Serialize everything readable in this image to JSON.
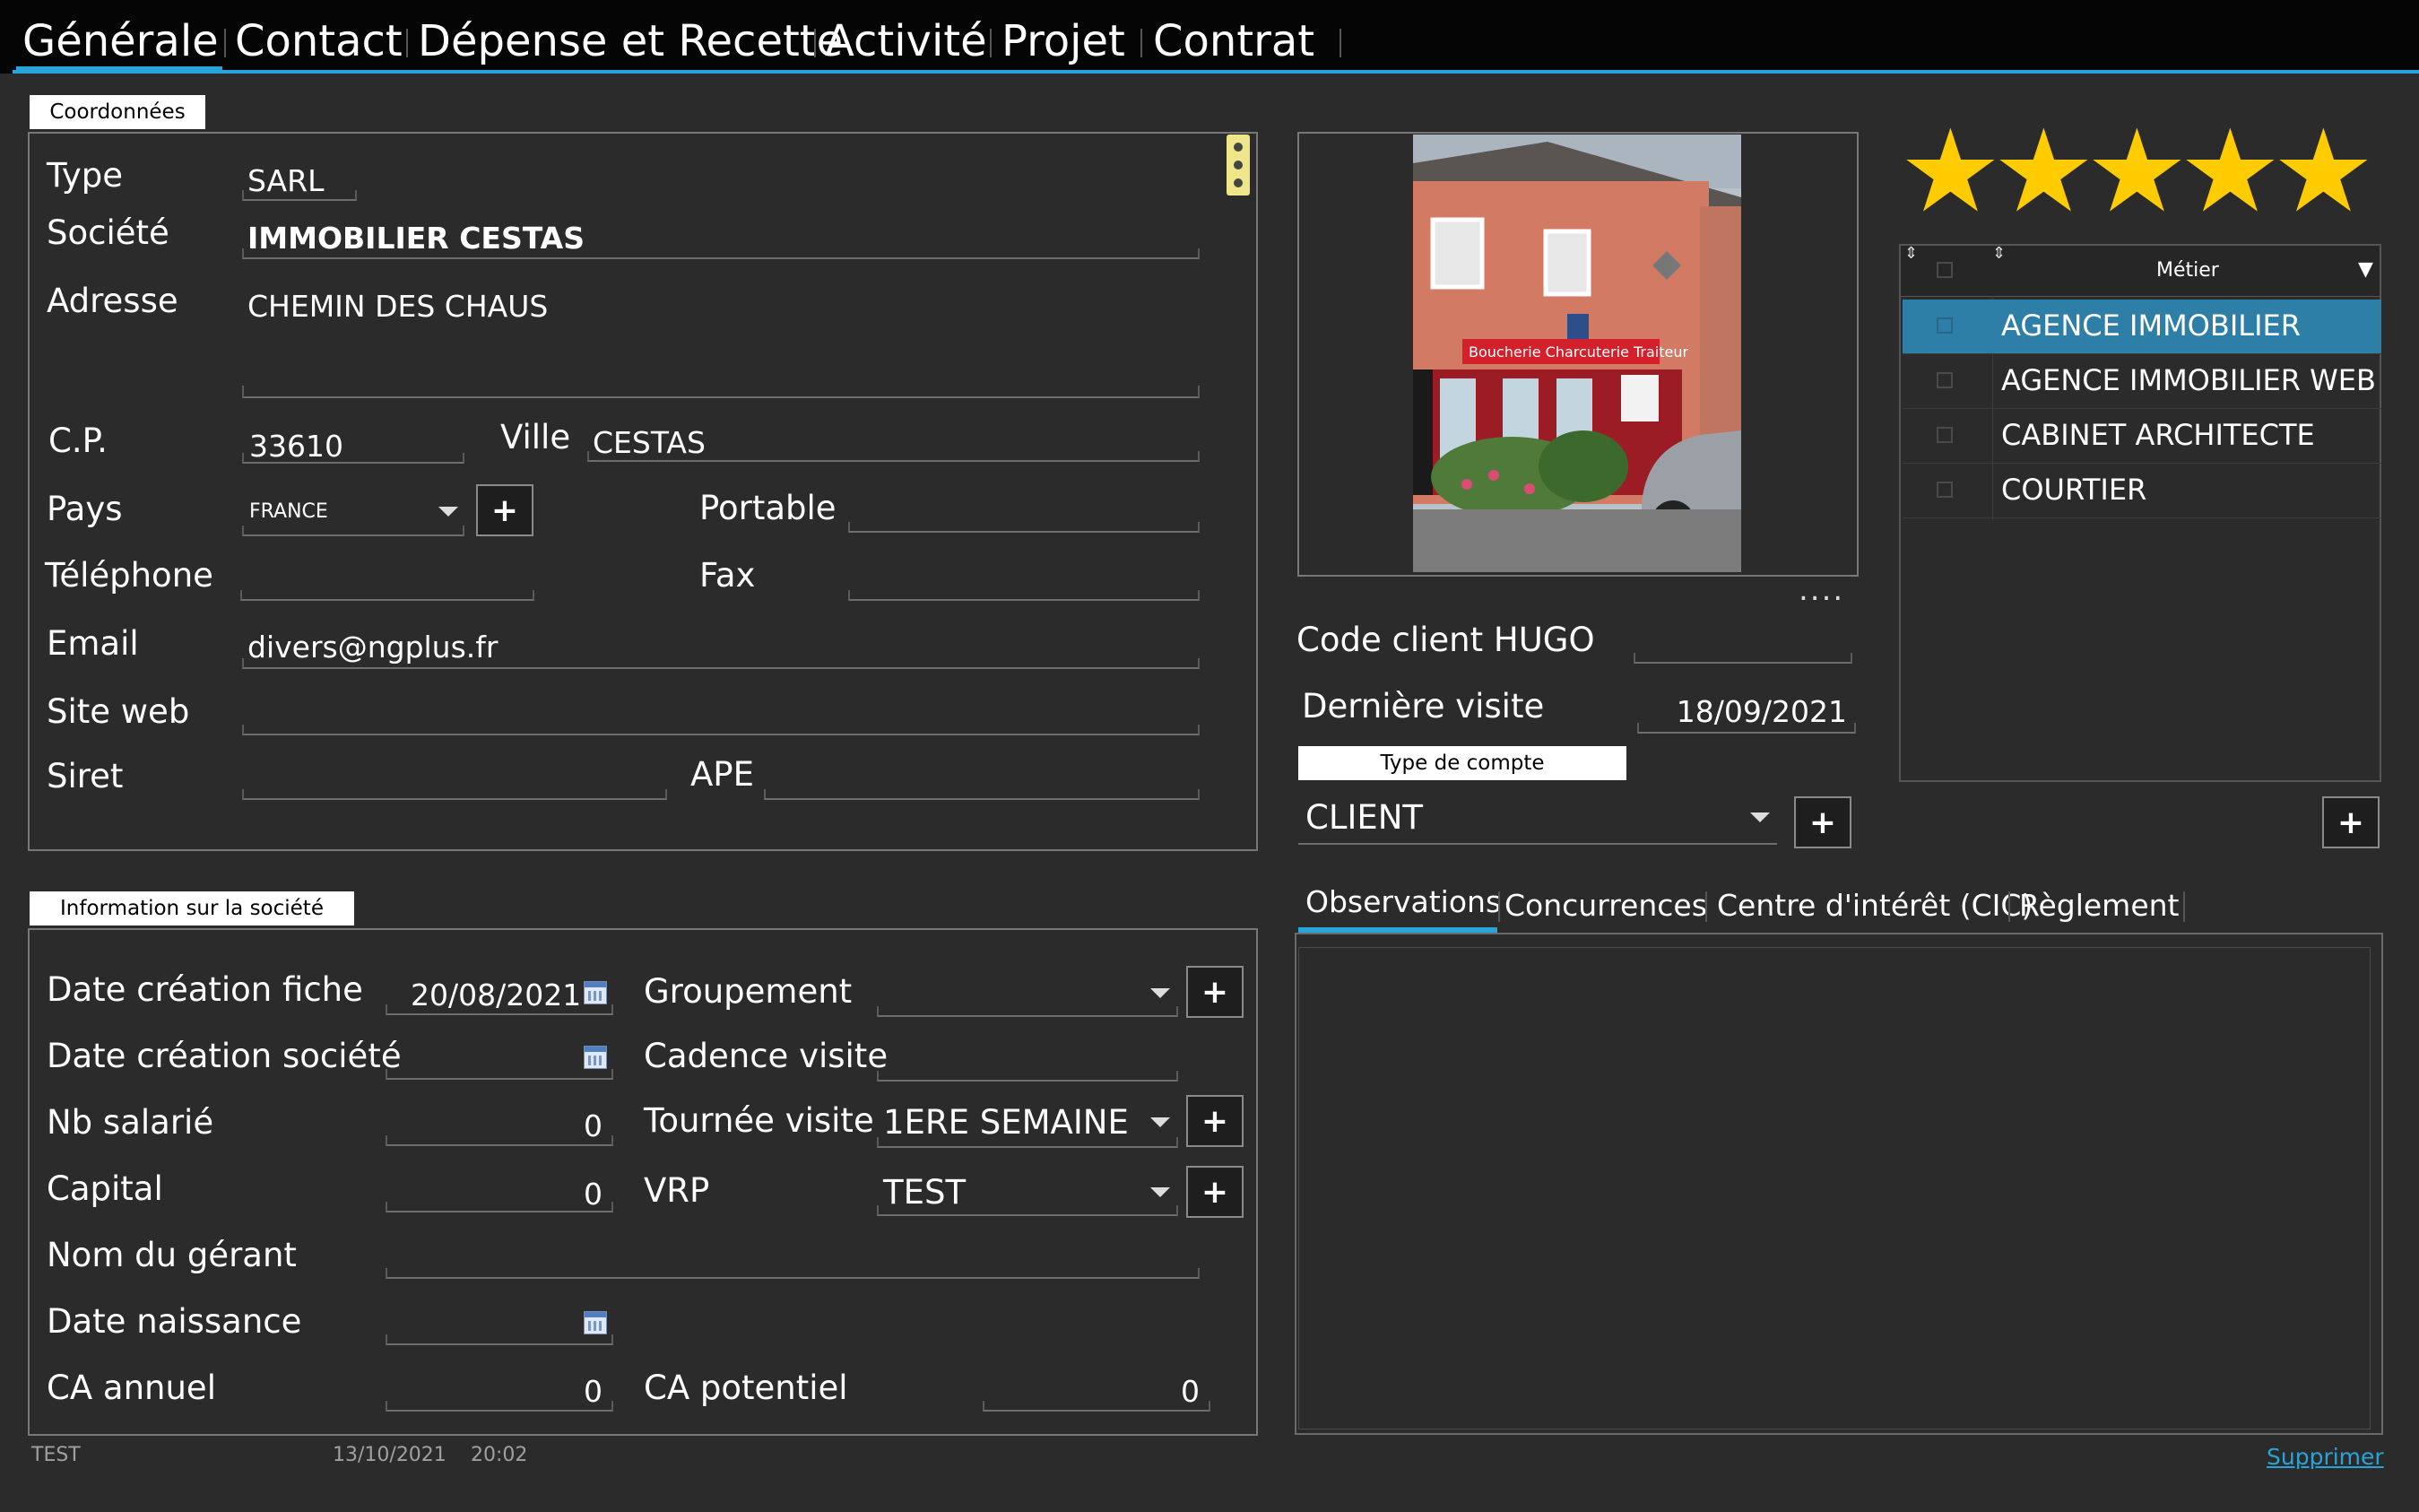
{
  "nav": {
    "tabs": [
      "Générale",
      "Contact",
      "Dépense et Recette",
      "Activité",
      "Projet",
      "Contrat"
    ]
  },
  "coordonnees": {
    "title": "Coordonnées",
    "type_label": "Type",
    "type_value": "SARL",
    "societe_label": "Société",
    "societe_value": "IMMOBILIER CESTAS",
    "adresse_label": "Adresse",
    "adresse_line1": "CHEMIN DES CHAUS",
    "adresse_line2": "",
    "cp_label": "C.P.",
    "cp_value": "33610",
    "ville_label": "Ville",
    "ville_value": "CESTAS",
    "pays_label": "Pays",
    "pays_value": "FRANCE",
    "portable_label": "Portable",
    "portable_value": "",
    "telephone_label": "Téléphone",
    "telephone_value": "",
    "fax_label": "Fax",
    "fax_value": "",
    "email_label": "Email",
    "email_value": "divers@ngplus.fr",
    "siteweb_label": "Site web",
    "siteweb_value": "",
    "siret_label": "Siret",
    "siret_value": "",
    "ape_label": "APE",
    "ape_value": ""
  },
  "info_societe": {
    "title": "Information sur la société",
    "date_creation_fiche_label": "Date création fiche",
    "date_creation_fiche_value": "20/08/2021",
    "date_creation_societe_label": "Date création société",
    "date_creation_societe_value": "",
    "nb_salarie_label": "Nb salarié",
    "nb_salarie_value": "0",
    "capital_label": "Capital",
    "capital_value": "0",
    "nom_gerant_label": "Nom du gérant",
    "nom_gerant_value": "",
    "date_naissance_label": "Date naissance",
    "date_naissance_value": "",
    "ca_annuel_label": "CA annuel",
    "ca_annuel_value": "0",
    "groupement_label": "Groupement",
    "groupement_value": "",
    "cadence_visite_label": "Cadence visite",
    "cadence_visite_value": "",
    "tournee_visite_label": "Tournée visite",
    "tournee_visite_value": "1ERE SEMAINE",
    "vrp_label": "VRP",
    "vrp_value": "TEST",
    "ca_potentiel_label": "CA potentiel",
    "ca_potentiel_value": "0"
  },
  "photo": {
    "shop_sign": "Boucherie Charcuterie Traiteur",
    "more_label": "...."
  },
  "client": {
    "code_client_label": "Code client HUGO",
    "code_client_value": "",
    "derniere_visite_label": "Dernière visite",
    "derniere_visite_value": "18/09/2021",
    "type_compte_title": "Type de compte",
    "type_compte_value": "CLIENT"
  },
  "rating": {
    "stars": 5,
    "max": 5,
    "color": "#ffcc00"
  },
  "metier_table": {
    "header": "Métier",
    "rows": [
      "AGENCE IMMOBILIER",
      "AGENCE IMMOBILIER WEB",
      "CABINET ARCHITECTE",
      "COURTIER"
    ],
    "selected_index": 0,
    "selected_color": "#2e7fa8"
  },
  "subtabs": [
    "Observations",
    "Concurrences",
    "Centre d'intérêt (CIC)",
    "Règlement"
  ],
  "footer": {
    "user": "TEST",
    "date": "13/10/2021",
    "time": "20:02",
    "delete_link": "Supprimer"
  },
  "icons": {
    "plus": "+",
    "more_vertical": "⋮",
    "calendar": "calendar-icon",
    "filter": "▼",
    "sort": "⇕"
  }
}
